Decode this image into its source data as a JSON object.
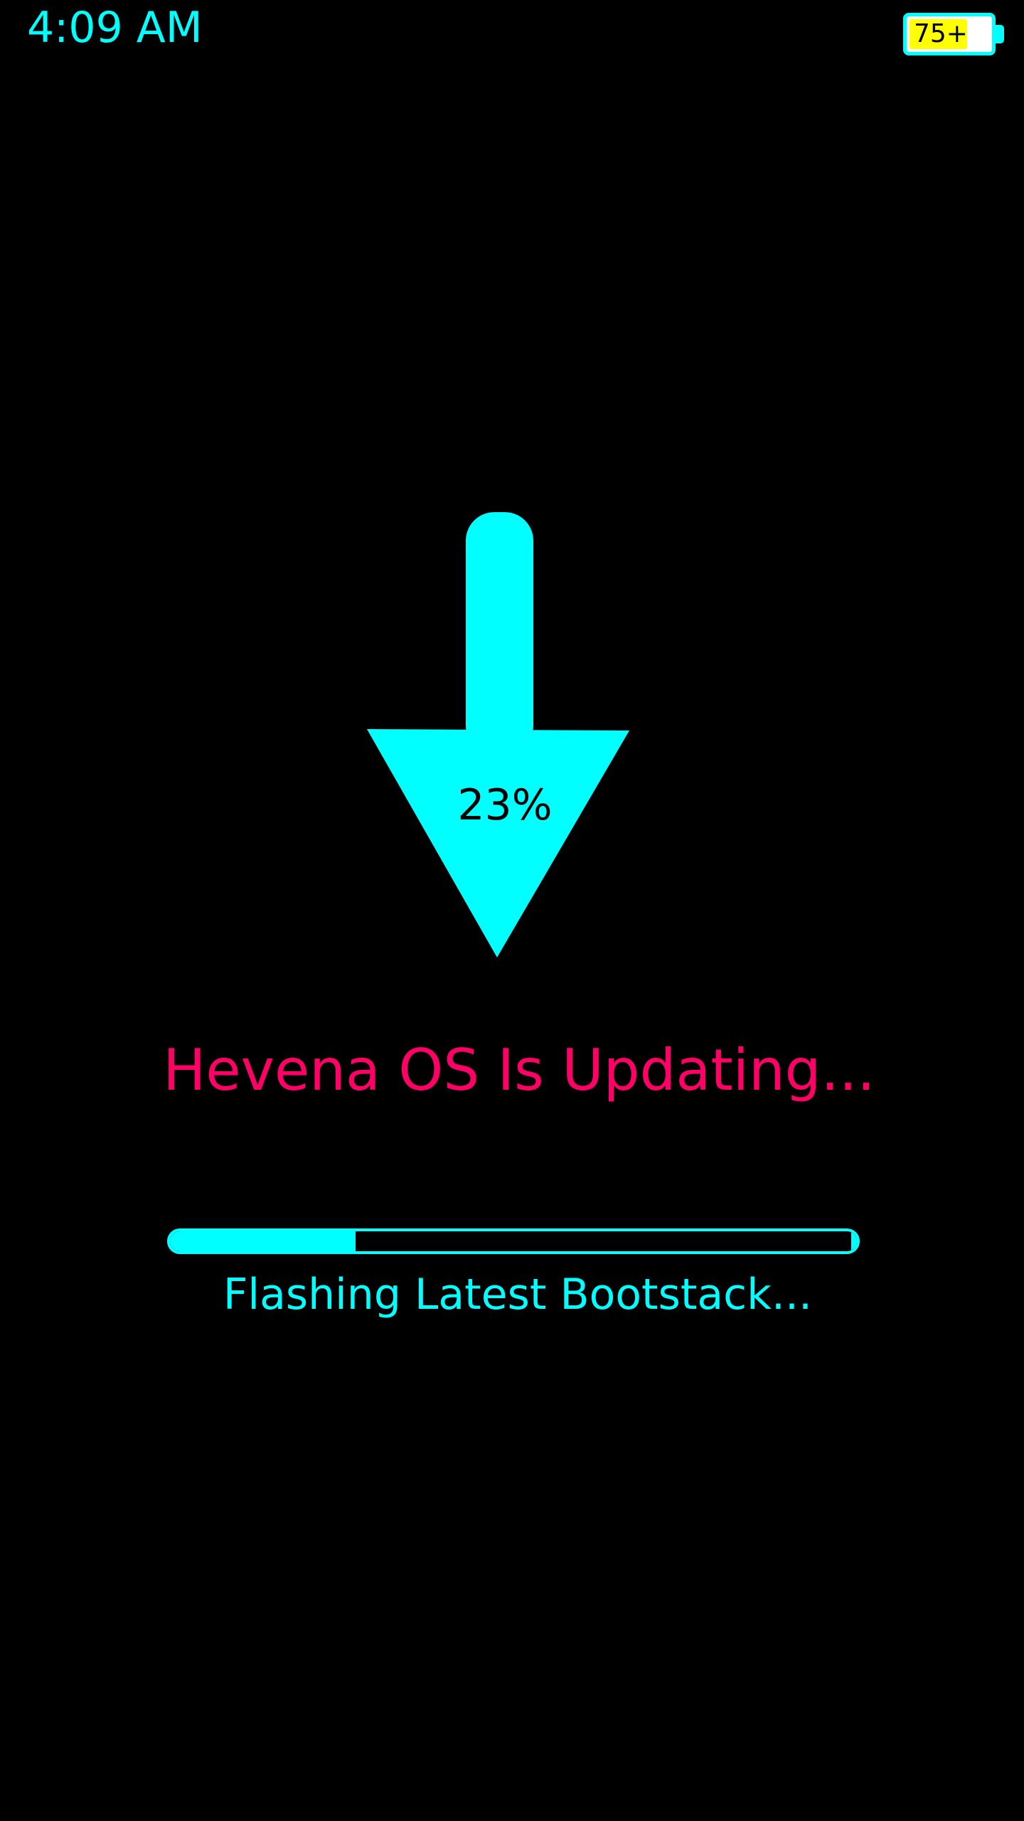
{
  "status_bar": {
    "time": "4:09 AM",
    "battery_label": "75+",
    "battery_level": 0.75
  },
  "update": {
    "percent_label": "23%",
    "progress": 0.27,
    "title": "Hevena OS Is Updating...",
    "step": "Flashing Latest Bootstack..."
  },
  "icons": {
    "download": "download-arrow-icon",
    "battery": "battery-icon"
  },
  "colors": {
    "background": "#000000",
    "accent": "#00ffff",
    "title": "#ff0066",
    "battery_fill": "#ffff00",
    "battery_body": "#ffffff"
  }
}
